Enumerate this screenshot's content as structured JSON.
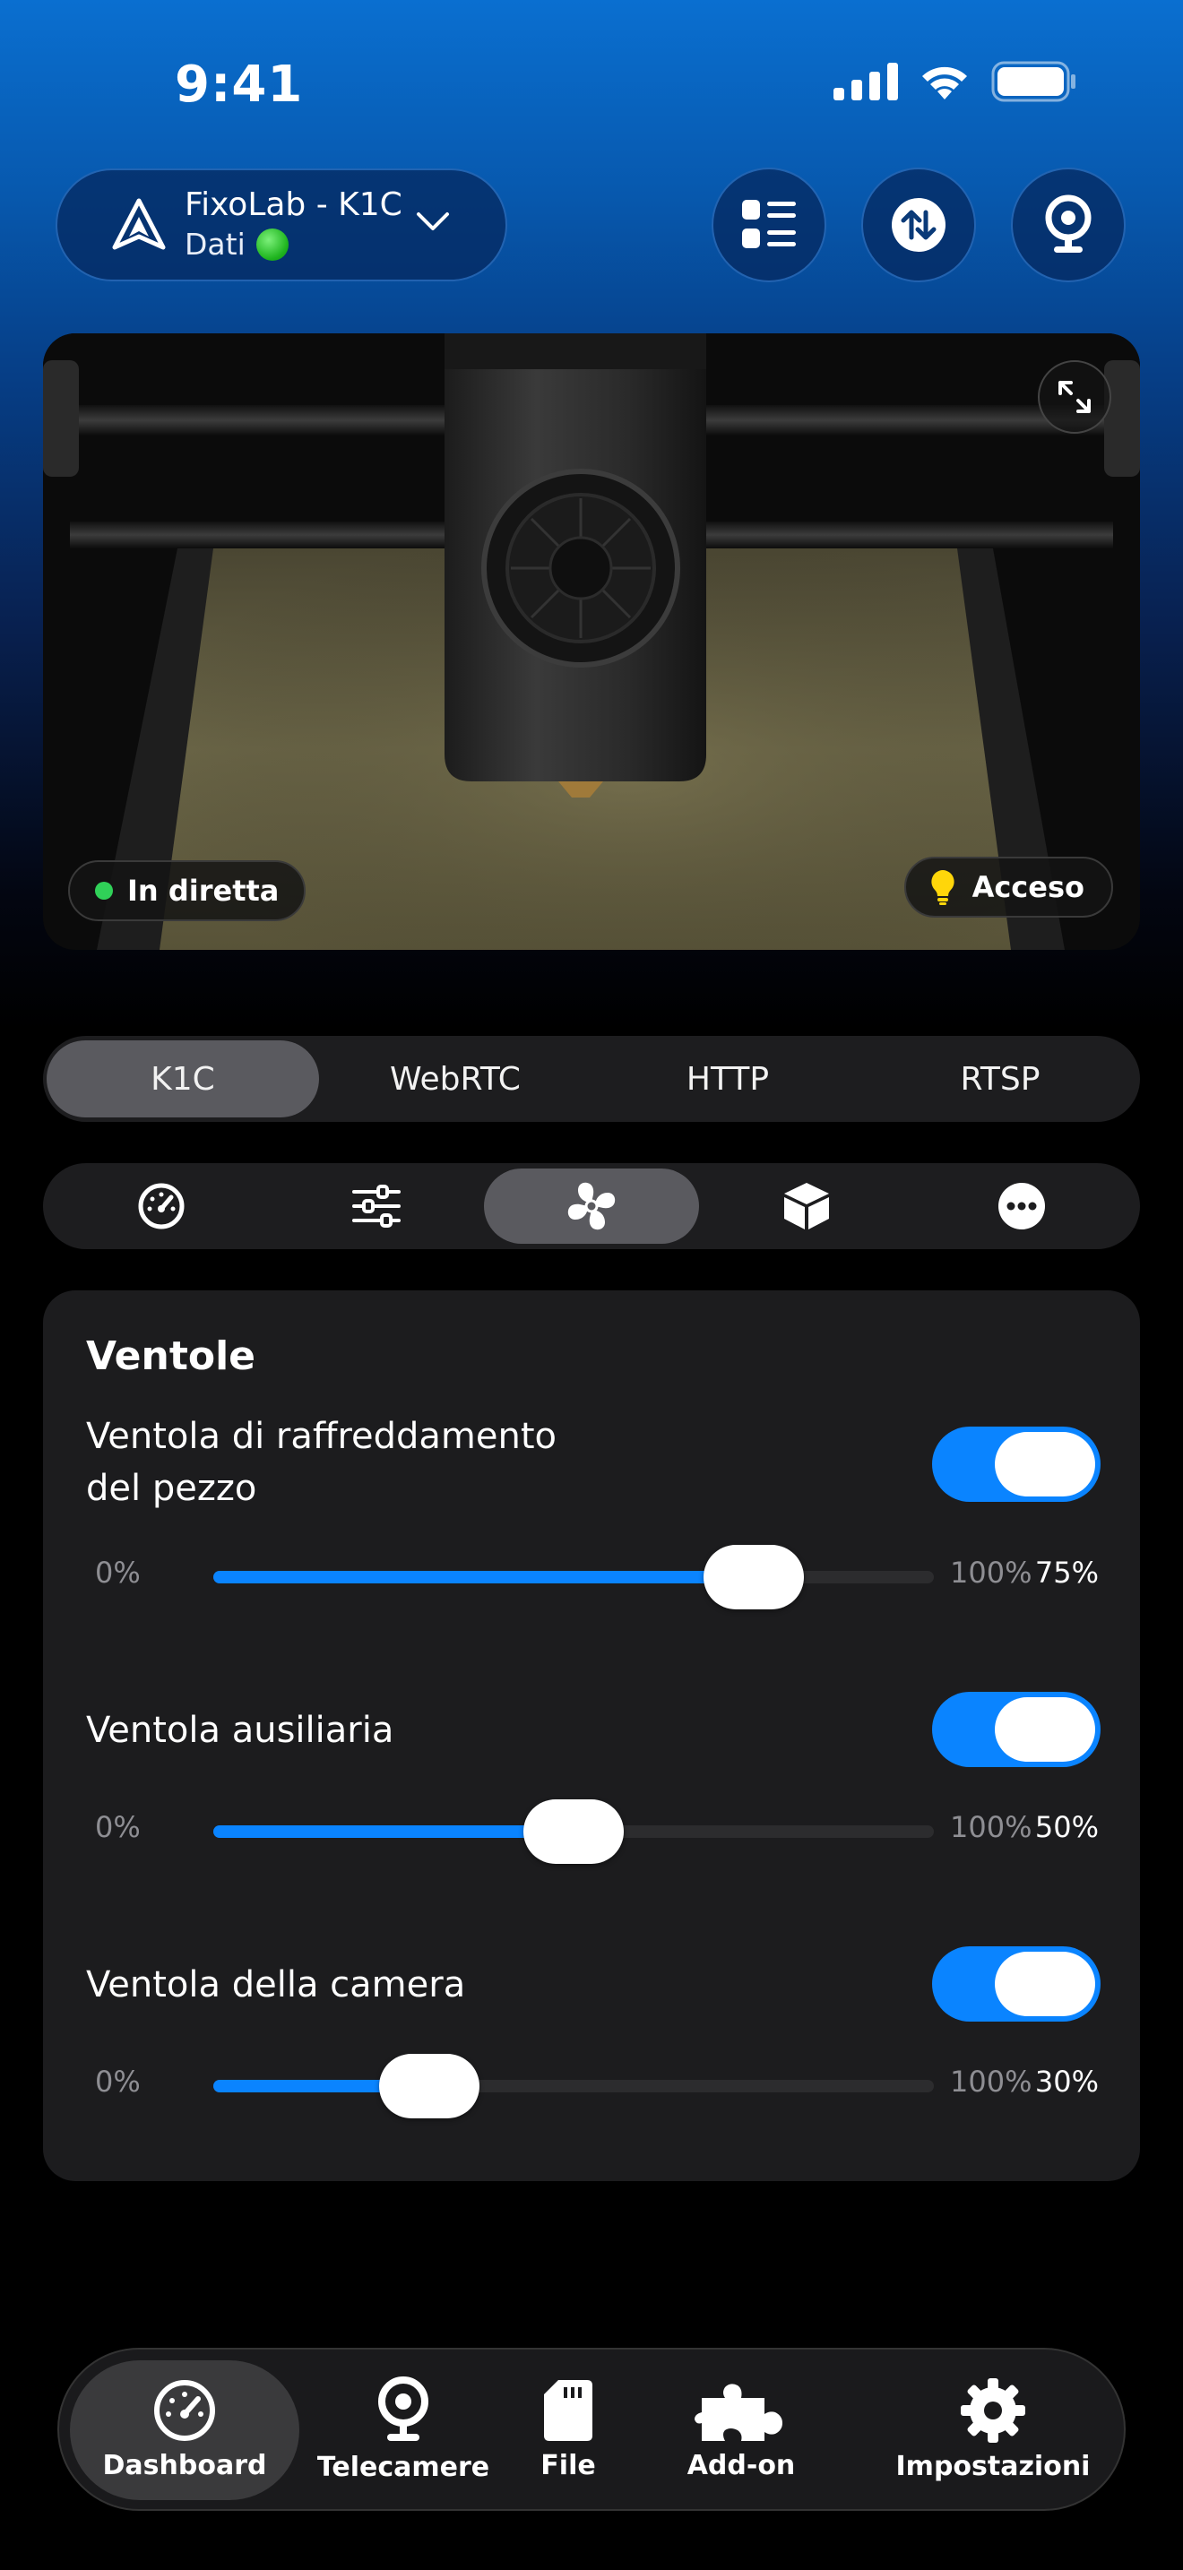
{
  "status_bar": {
    "time": "9:41"
  },
  "header": {
    "printer_name": "FixoLab - K1C",
    "printer_sub": "Dati",
    "icons": [
      "dropdown-chevron-icon",
      "list-icon",
      "transfer-icon",
      "webcam-icon"
    ]
  },
  "camera": {
    "live_label": "In diretta",
    "light_label": "Acceso",
    "live_color": "#30d158",
    "light_color": "#ffd60a"
  },
  "stream_tabs": [
    "K1C",
    "WebRTC",
    "HTTP",
    "RTSP"
  ],
  "stream_active": "K1C",
  "control_tabs": [
    "dashboard-gauge-icon",
    "sliders-icon",
    "fan-icon",
    "cube-icon",
    "more-icon"
  ],
  "control_active": "fan-icon",
  "fans": {
    "title": "Ventole",
    "items": [
      {
        "name_line1": "Ventola di raffreddamento",
        "name_line2": "del pezzo",
        "enabled": true,
        "min": "0%",
        "max": "100%",
        "value": 75,
        "value_label": "75%"
      },
      {
        "name_line1": "Ventola ausiliaria",
        "name_line2": "",
        "enabled": true,
        "min": "0%",
        "max": "100%",
        "value": 50,
        "value_label": "50%"
      },
      {
        "name_line1": "Ventola della camera",
        "name_line2": "",
        "enabled": true,
        "min": "0%",
        "max": "100%",
        "value": 30,
        "value_label": "30%"
      }
    ]
  },
  "bottom_nav": {
    "items": [
      "Dashboard",
      "Telecamere",
      "File",
      "Add-on",
      "Impostazioni"
    ],
    "active": "Dashboard"
  },
  "colors": {
    "accent": "#0a84ff",
    "card": "#1c1c1e"
  }
}
